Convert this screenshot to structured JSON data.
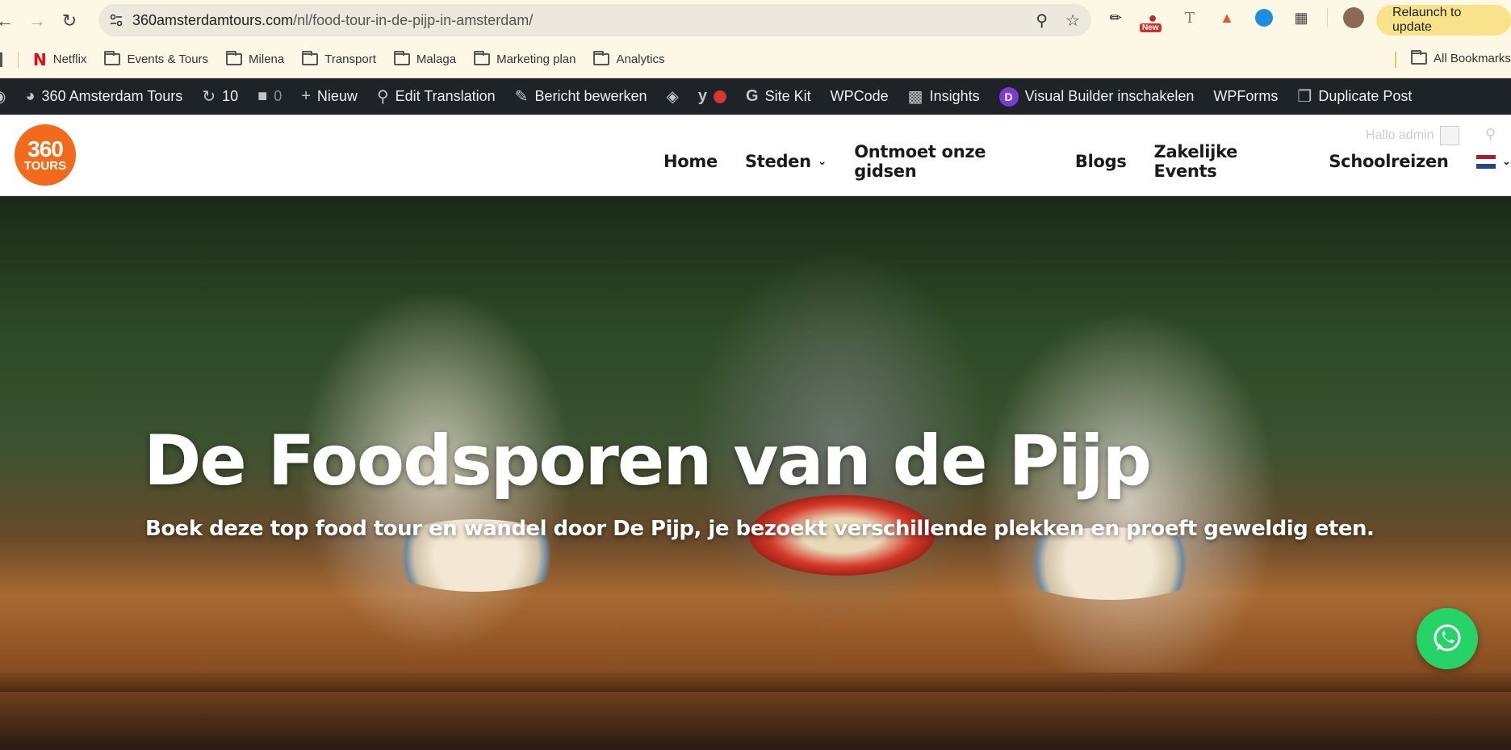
{
  "browser": {
    "url_host": "360amsterdamtours.com",
    "url_path": "/nl/food-tour-in-de-pijp-in-amsterdam/",
    "relaunch_label": "Relaunch to update",
    "extension_badge": "New"
  },
  "bookmarks": {
    "items": [
      "Netflix",
      "Events & Tours",
      "Milena",
      "Transport",
      "Malaga",
      "Marketing plan",
      "Analytics"
    ],
    "all_label": "All Bookmarks"
  },
  "adminbar": {
    "site_name": "360 Amsterdam Tours",
    "updates_count": "10",
    "comments_count": "0",
    "new_label": "Nieuw",
    "edit_translation": "Edit Translation",
    "edit_post": "Bericht bewerken",
    "site_kit": "Site Kit",
    "wpcode": "WPCode",
    "insights": "Insights",
    "visual_builder": "Visual Builder inschakelen",
    "wpforms": "WPForms",
    "duplicate_post": "Duplicate Post"
  },
  "site": {
    "logo_num": "360",
    "logo_word": "TOURS",
    "hello_admin": "Hallo admin",
    "nav": [
      {
        "label": "Home"
      },
      {
        "label": "Steden"
      },
      {
        "label": "Ontmoet onze gidsen"
      },
      {
        "label": "Blogs"
      },
      {
        "label": "Zakelijke Events"
      },
      {
        "label": "Schoolreizen"
      }
    ]
  },
  "hero": {
    "title": "De Foodsporen van de Pijp",
    "subtitle": "Boek deze top food tour en wandel door De Pijp, je bezoekt verschillende plekken en proeft geweldig eten."
  },
  "colors": {
    "brand_orange": "#f26a1b",
    "whatsapp_green": "#25d366",
    "adminbar_bg": "#1d2327"
  }
}
